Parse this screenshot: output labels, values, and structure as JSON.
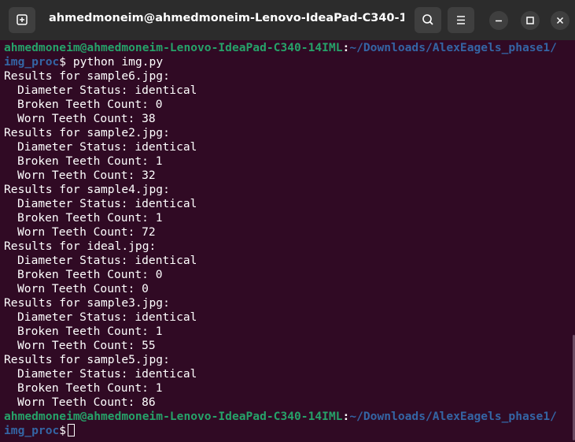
{
  "header": {
    "title": "ahmedmoneim@ahmedmoneim-Lenovo-IdeaPad-C340-14IML..."
  },
  "prompt": {
    "user_host": "ahmedmoneim@ahmedmoneim-Lenovo-IdeaPad-C340-14IML",
    "colon": ":",
    "path_line1": "~/Downloads/AlexEagels_phase1/",
    "path_line2": "img_proc",
    "dollar": "$",
    "command": " python img.py"
  },
  "results": [
    {
      "header": "Results for sample6.jpg:",
      "diameter": "Diameter Status: identical",
      "broken": "Broken Teeth Count: 0",
      "worn": "Worn Teeth Count: 38"
    },
    {
      "header": "Results for sample2.jpg:",
      "diameter": "Diameter Status: identical",
      "broken": "Broken Teeth Count: 1",
      "worn": "Worn Teeth Count: 32"
    },
    {
      "header": "Results for sample4.jpg:",
      "diameter": "Diameter Status: identical",
      "broken": "Broken Teeth Count: 1",
      "worn": "Worn Teeth Count: 72"
    },
    {
      "header": "Results for ideal.jpg:",
      "diameter": "Diameter Status: identical",
      "broken": "Broken Teeth Count: 0",
      "worn": "Worn Teeth Count: 0"
    },
    {
      "header": "Results for sample3.jpg:",
      "diameter": "Diameter Status: identical",
      "broken": "Broken Teeth Count: 1",
      "worn": "Worn Teeth Count: 55"
    },
    {
      "header": "Results for sample5.jpg:",
      "diameter": "Diameter Status: identical",
      "broken": "Broken Teeth Count: 1",
      "worn": "Worn Teeth Count: 86"
    }
  ],
  "icons": {
    "new_tab": "new-tab-icon",
    "search": "search-icon",
    "menu": "hamburger-menu-icon",
    "minimize": "minimize-icon",
    "maximize": "maximize-icon",
    "close": "close-icon"
  },
  "colors": {
    "terminal_bg": "#300a24",
    "header_bg": "#2c2c2c",
    "prompt_user": "#26a269",
    "prompt_path": "#3465a4",
    "text": "#ffffff"
  }
}
